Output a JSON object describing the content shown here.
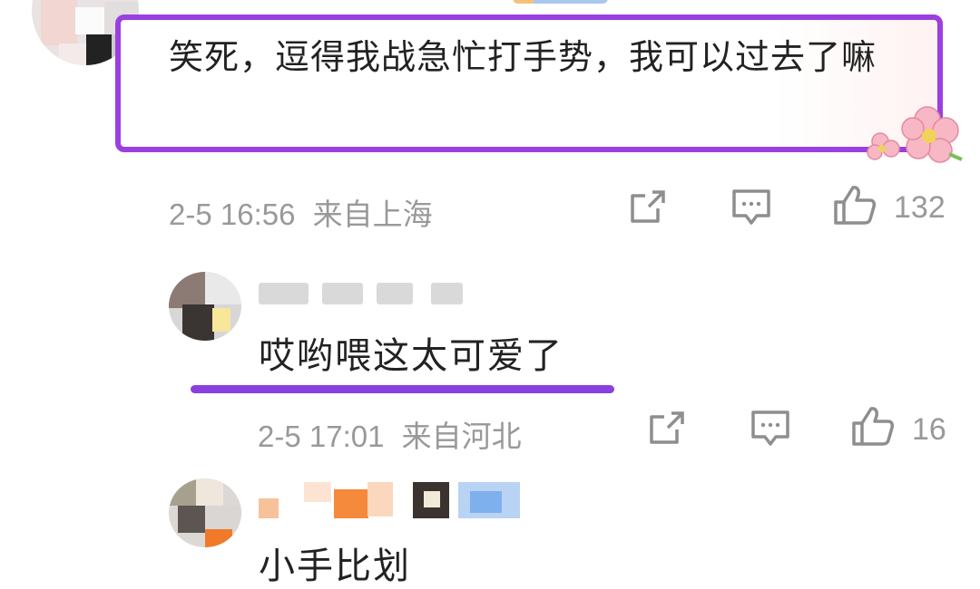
{
  "comment_main": {
    "text": "笑死，逗得我战急忙打手势，我可以过去了嘛",
    "time": "2-5 16:56",
    "location": "来自上海",
    "like_count": "132"
  },
  "reply_1": {
    "text": "哎哟喂这太可爱了",
    "time": "2-5 17:01",
    "location": "来自河北",
    "like_count": "16"
  },
  "reply_2": {
    "text": "小手比划"
  },
  "colors": {
    "highlight": "#9b3fe0",
    "meta_text": "#999999",
    "body_text": "#222222"
  },
  "icons": [
    "share-icon",
    "comment-icon",
    "like-icon"
  ]
}
